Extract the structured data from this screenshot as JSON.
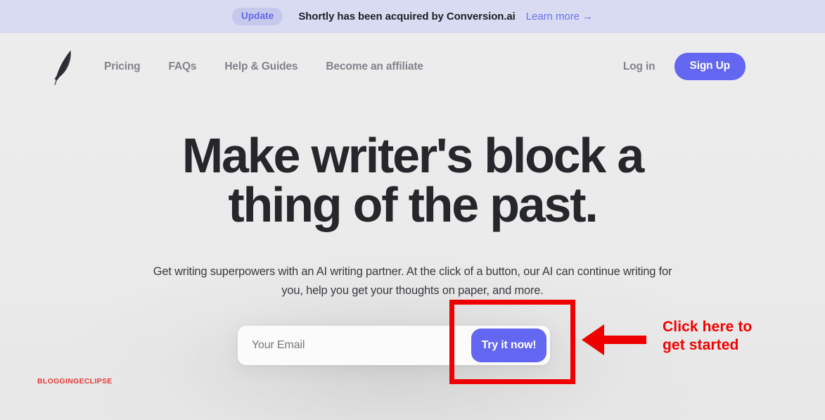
{
  "banner": {
    "pill_label": "Update",
    "message": "Shortly has been acquired by Conversion.ai",
    "link_label": "Learn more →",
    "bg_color": "#d8dbf1",
    "pill_bg_color": "#c6c9ec",
    "link_color": "#6d70ee"
  },
  "nav": {
    "logo_name": "feather-quill-logo",
    "links": [
      {
        "label": "Pricing"
      },
      {
        "label": "FAQs"
      },
      {
        "label": "Help & Guides"
      },
      {
        "label": "Become an affiliate"
      }
    ],
    "login_label": "Log in",
    "signup_label": "Sign Up",
    "accent_color": "#6366f1"
  },
  "hero": {
    "headline": "Make writer's block a thing of the past.",
    "subheadline": "Get writing superpowers with an AI writing partner. At the click of a button, our AI can continue writing for you, help you get your thoughts on paper, and more.",
    "headline_color": "#26272b"
  },
  "form": {
    "email_placeholder": "Your Email",
    "email_value": "",
    "submit_label": "Try it now!",
    "submit_color": "#6366f1"
  },
  "annotation": {
    "text_line1": "Click here to",
    "text_line2": "get started",
    "color": "#f20000",
    "arrow_direction": "left",
    "highlight_target": "Try it now! button"
  },
  "watermark": {
    "label": "BLOGGINGECLIPSE",
    "color": "#e23b3b"
  }
}
